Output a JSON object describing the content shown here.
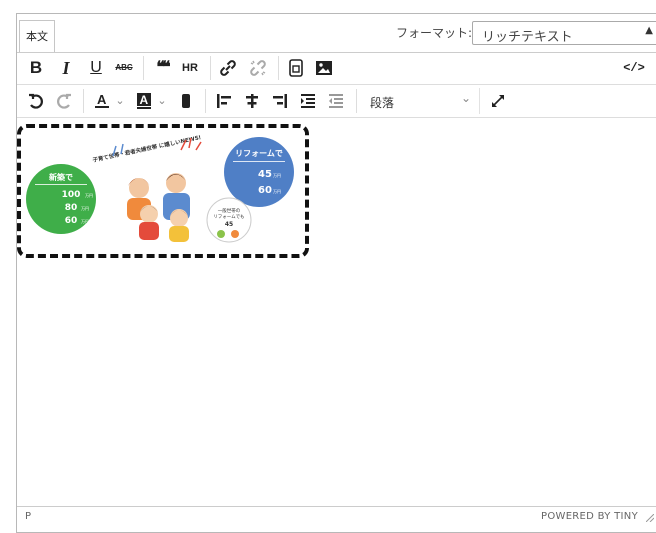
{
  "tabs": {
    "body_tab": "本文"
  },
  "format": {
    "label": "フォーマット:",
    "value": "リッチテキスト"
  },
  "toolbar1": {
    "bold": "B",
    "italic": "I",
    "underline": "U",
    "strike": "ABC",
    "quote": "❝❝",
    "hr": "HR",
    "link_icon": "link-icon",
    "unlink_icon": "unlink-icon",
    "file_icon": "file-icon",
    "image_icon": "image-icon",
    "code": "</>"
  },
  "toolbar2": {
    "paragraph_select": "段落"
  },
  "banner": {
    "headline": "子育て世帯・若者夫婦世帯 に嬉しいNEWS!",
    "green_circle": {
      "title": "新築で",
      "amounts": [
        "100",
        "80",
        "60"
      ],
      "unit": "万円"
    },
    "blue_circle": {
      "title": "リフォームで",
      "amounts": [
        "45",
        "60"
      ],
      "unit": "万円"
    },
    "small_circle": {
      "line1": "一般世帯の",
      "line2": "リフォームでも",
      "amount": "45"
    }
  },
  "statusbar": {
    "path": "P",
    "powered": "POWERED BY TINY"
  }
}
